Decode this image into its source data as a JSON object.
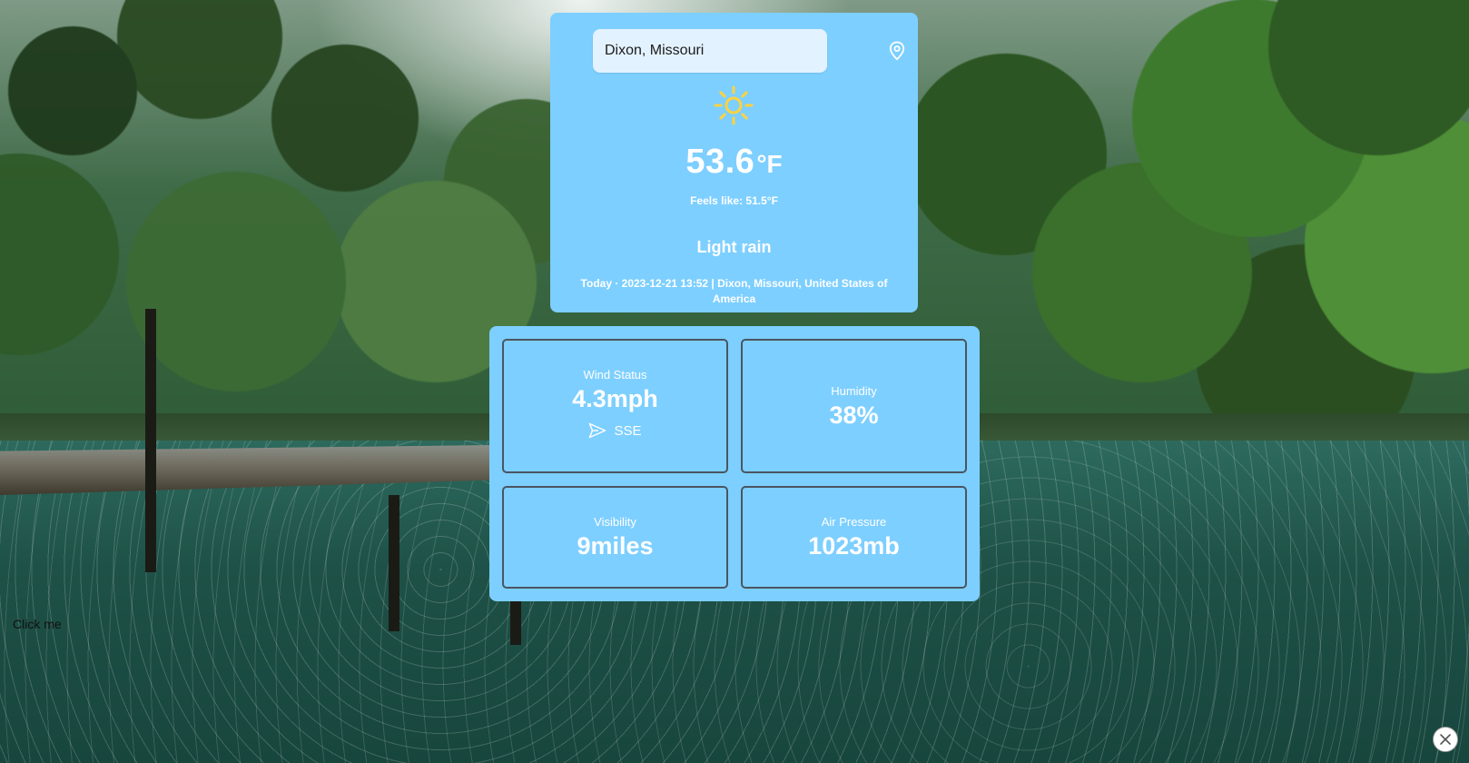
{
  "search": {
    "value": "Dixon, Missouri",
    "location_icon": "map-pin-icon"
  },
  "weather": {
    "icon": "sun-icon",
    "temperature": "53.6",
    "unit": "°F",
    "feels_like": "Feels like: 51.5°F",
    "condition": "Light rain",
    "date_location": "Today · 2023-12-21 13:52 | Dixon, Missouri, United States of America"
  },
  "stats": {
    "wind": {
      "label": "Wind Status",
      "value": "4.3mph",
      "direction": "SSE",
      "direction_icon": "send-arrow-icon"
    },
    "humidity": {
      "label": "Humidity",
      "value": "38%"
    },
    "visibility": {
      "label": "Visibility",
      "value": "9miles"
    },
    "pressure": {
      "label": "Air Pressure",
      "value": "1023mb"
    }
  },
  "misc": {
    "click_me": "Click me",
    "close_icon": "close-icon"
  },
  "colors": {
    "card_background": "#7dcfff",
    "input_background": "#e3f2ff",
    "sun": "#ffd23f",
    "text": "#ffffff",
    "tile_border": "#4a5560"
  }
}
